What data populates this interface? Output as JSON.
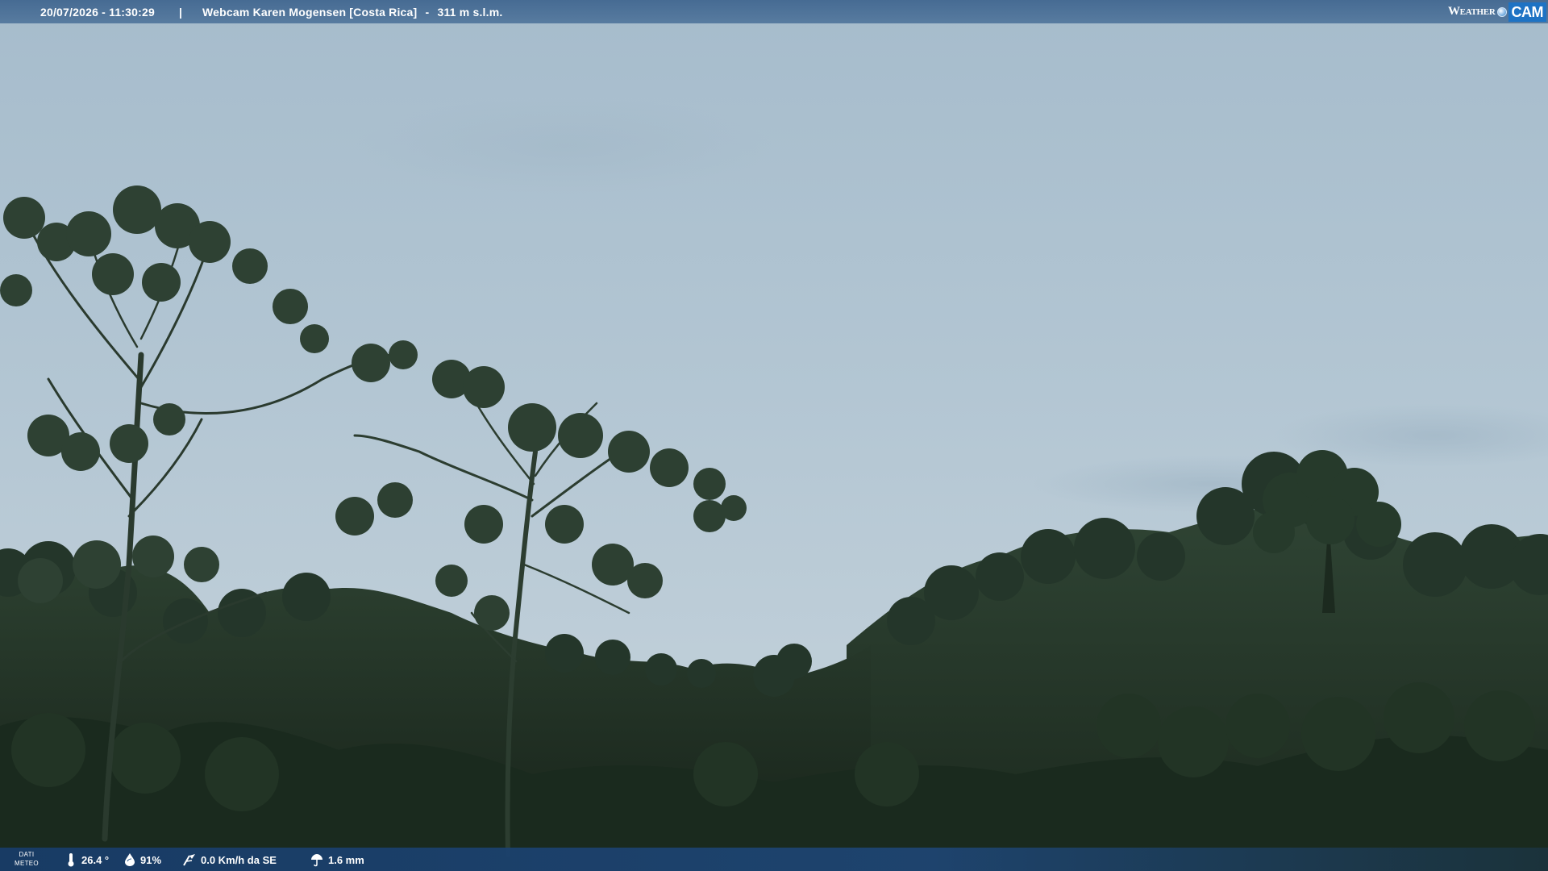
{
  "top_bar": {
    "datetime": "20/07/2026 - 11:30:29",
    "separator": "|",
    "title": "Webcam Karen Mogensen [Costa Rica]",
    "altitude": "311 m s.l.m.",
    "alt_separator": "-"
  },
  "logo": {
    "weather": "Weather",
    "cam": "CAM"
  },
  "weather_bar": {
    "label_line1": "DATI",
    "label_line2": "METEO",
    "temperature": "26.4 °",
    "humidity": "91%",
    "wind": "0.0 Km/h da SE",
    "rain": "1.6 mm",
    "icons": {
      "temperature": "thermometer-icon",
      "humidity": "humidity-drop-icon",
      "wind": "wind-icon",
      "rain": "rain-icon"
    }
  },
  "colors": {
    "sky_top": "#a9c0d0",
    "sky_bottom": "#c2d1dc",
    "foliage_dark": "#1c2a20",
    "foliage_mid": "#2e4432",
    "bar_blue": "#2a5a8c",
    "logo_blue": "#1e73c4"
  }
}
